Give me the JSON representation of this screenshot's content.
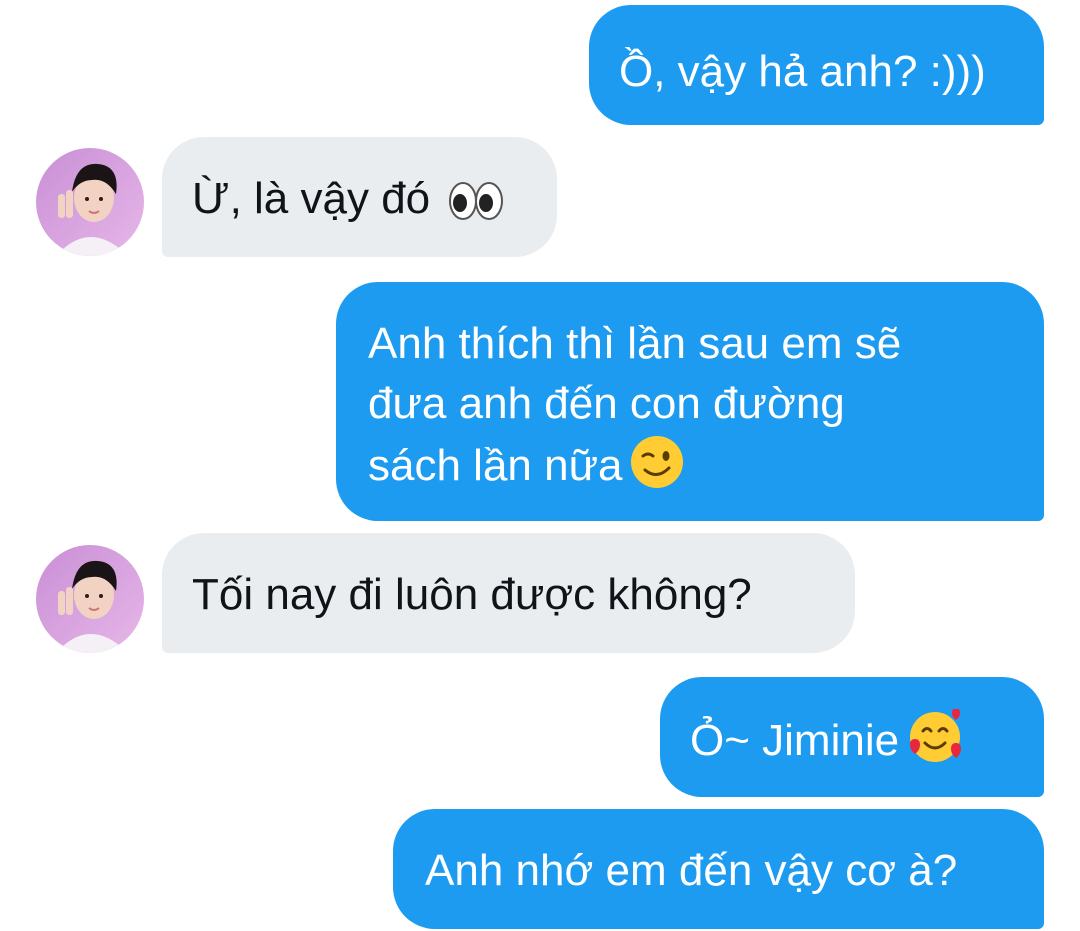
{
  "conversation": {
    "messages": [
      {
        "from": "me",
        "text": "Ồ, vậy hả anh? :)))"
      },
      {
        "from": "them",
        "text": "Ừ, là vậy đó",
        "emoji": "eyes-emoji"
      },
      {
        "from": "me",
        "lines": [
          "Anh thích thì lần sau em sẽ",
          "đưa anh đến con đường",
          "sách lần nữa"
        ],
        "emoji": "winking-face-emoji"
      },
      {
        "from": "them",
        "text": "Tối nay đi luôn được không?"
      },
      {
        "from": "me",
        "text": "Ỏ~ Jiminie",
        "emoji": "smiling-face-with-hearts-emoji"
      },
      {
        "from": "me",
        "text": "Anh nhớ em đến vậy cơ à?"
      }
    ]
  },
  "theme": {
    "outgoing_bubble": "#1d9bf0",
    "incoming_bubble": "#e9edf0",
    "outgoing_text": "#ffffff",
    "incoming_text": "#0f1419"
  }
}
